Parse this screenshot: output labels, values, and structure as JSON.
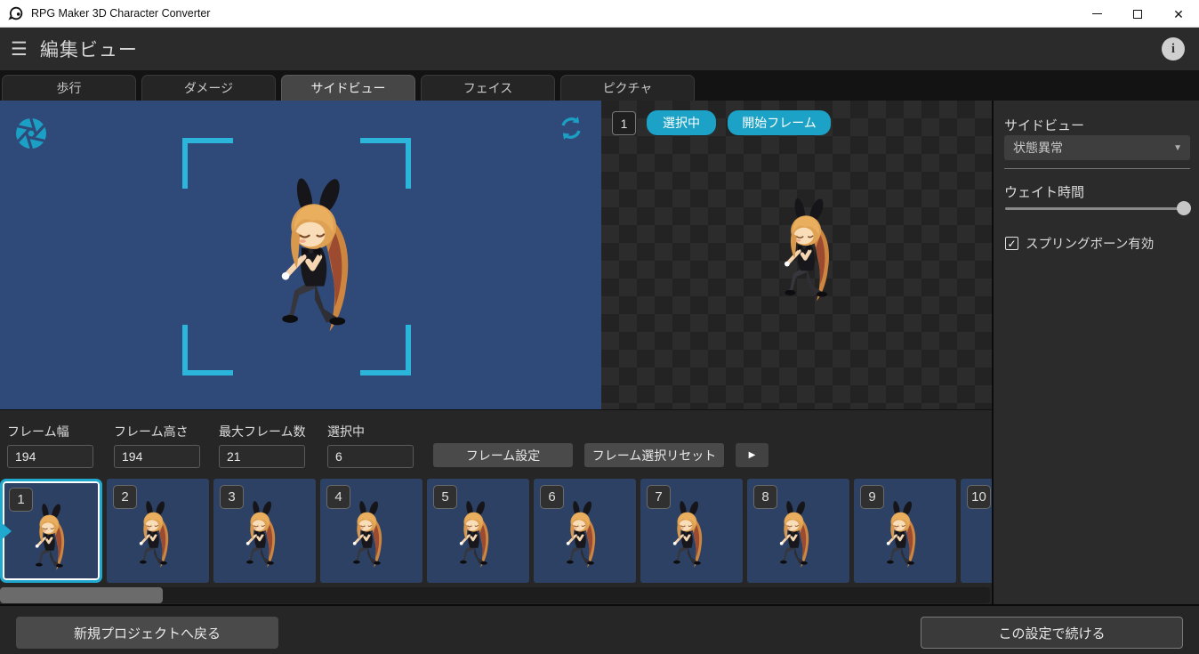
{
  "colors": {
    "accent": "#1ba2c6",
    "accent_bright": "#2cb5da",
    "preview_bg": "#2f4a78",
    "tile_bg": "#2c4164"
  },
  "titlebar": {
    "title": "RPG Maker 3D Character Converter"
  },
  "header": {
    "title": "編集ビュー"
  },
  "tabs": [
    {
      "label": "歩行"
    },
    {
      "label": "ダメージ"
    },
    {
      "label": "サイドビュー",
      "active": true
    },
    {
      "label": "フェイス"
    },
    {
      "label": "ピクチャ"
    }
  ],
  "preview": {
    "frame_number": "1",
    "selected_button": "選択中",
    "start_frame_button": "開始フレーム"
  },
  "sidebar": {
    "title": "サイドビュー",
    "state_dropdown_value": "状態異常",
    "wait_time_label": "ウェイト時間",
    "wait_time_percent": 100,
    "spring_bone_label": "スプリングボーン有効",
    "spring_bone_checked": true
  },
  "frame_controls": {
    "fields": [
      {
        "label": "フレーム幅",
        "value": "194"
      },
      {
        "label": "フレーム高さ",
        "value": "194"
      },
      {
        "label": "最大フレーム数",
        "value": "21"
      },
      {
        "label": "選択中",
        "value": "6"
      }
    ],
    "frame_set_button": "フレーム設定",
    "frame_reset_button": "フレーム選択リセット"
  },
  "filmstrip": {
    "frames": [
      {
        "num": "1",
        "selected": true
      },
      {
        "num": "2"
      },
      {
        "num": "3"
      },
      {
        "num": "4"
      },
      {
        "num": "5"
      },
      {
        "num": "6"
      },
      {
        "num": "7"
      },
      {
        "num": "8"
      },
      {
        "num": "9"
      },
      {
        "num": "10"
      }
    ]
  },
  "footer": {
    "back_button": "新規プロジェクトへ戻る",
    "continue_button": "この設定で続ける"
  },
  "icons": {
    "hamburger": "☰",
    "info": "i",
    "close": "✕",
    "play": "▶",
    "caret": "▼",
    "check": "✓"
  }
}
